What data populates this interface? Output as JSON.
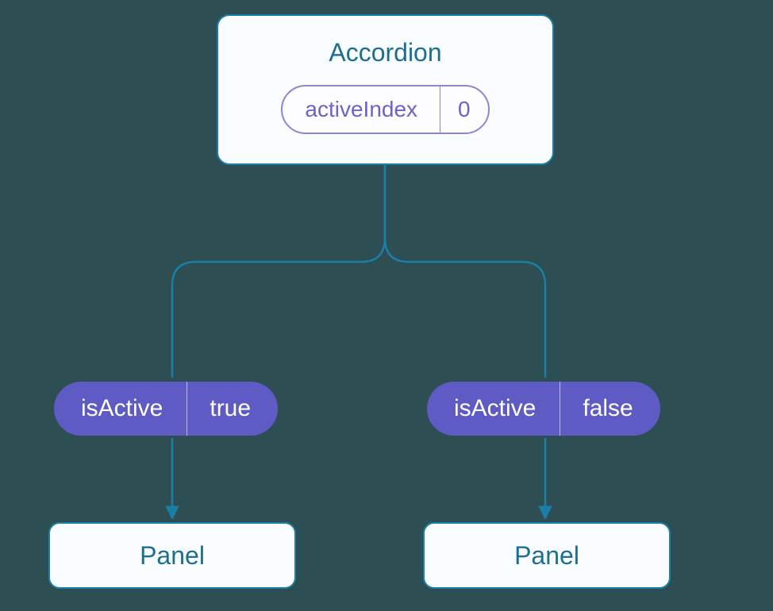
{
  "accordion": {
    "title": "Accordion",
    "state": {
      "name": "activeIndex",
      "value": "0"
    }
  },
  "children": [
    {
      "prop": {
        "name": "isActive",
        "value": "true"
      },
      "panel": {
        "label": "Panel"
      }
    },
    {
      "prop": {
        "name": "isActive",
        "value": "false"
      },
      "panel": {
        "label": "Panel"
      }
    }
  ],
  "colors": {
    "bg": "#2d4f53",
    "boxBorder": "#1b7ea6",
    "boxFill": "#fafdff",
    "textTeal": "#1d6f91",
    "pillPurple": "#5f5bc5",
    "statePurple": "#6b64c8"
  }
}
